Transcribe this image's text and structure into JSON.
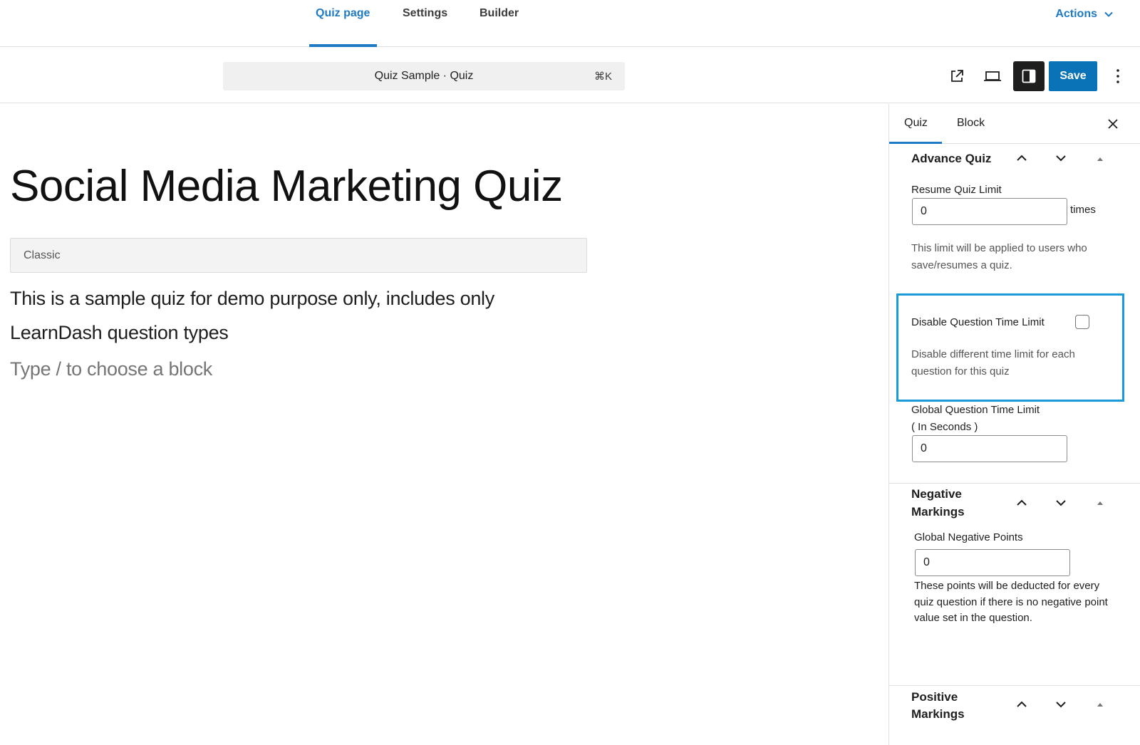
{
  "top_tabs": [
    {
      "label": "Quiz page",
      "active": true
    },
    {
      "label": "Settings",
      "active": false
    },
    {
      "label": "Builder",
      "active": false
    }
  ],
  "actions_label": "Actions",
  "command_bar": {
    "label": "Quiz Sample · Quiz",
    "shortcut": "⌘K"
  },
  "toolbar": {
    "icons": [
      "external-link-icon",
      "desktop-preview-icon",
      "sidebar-toggle-icon",
      "more-options-icon"
    ],
    "save_label": "Save"
  },
  "editor": {
    "title": "Social Media Marketing Quiz",
    "classic_block_label": "Classic",
    "paragraph": "This is a sample quiz for demo purpose only, includes only LearnDash question types",
    "placeholder": "Type / to choose a block"
  },
  "sidebar": {
    "tabs": [
      {
        "label": "Quiz",
        "active": true
      },
      {
        "label": "Block",
        "active": false
      }
    ],
    "advance_quiz": {
      "title": "Advance Quiz",
      "resume_limit_label": "Resume Quiz Limit",
      "resume_limit_value": "0",
      "resume_limit_suffix": "times",
      "resume_limit_help": "This limit will be applied to users who save/resumes a quiz.",
      "disable_time_limit_label": "Disable Question Time Limit",
      "disable_time_limit_checked": false,
      "disable_time_limit_help": "Disable different time limit for each question for this quiz",
      "global_time_limit_label_1": "Global Question Time Limit",
      "global_time_limit_label_2": "( In Seconds )",
      "global_time_limit_value": "0"
    },
    "negative_markings": {
      "title_line1": "Negative",
      "title_line2": "Markings",
      "points_label": "Global Negative Points",
      "points_value": "0",
      "help": "These points will be deducted for every quiz question if there is no negative point value set in the question."
    },
    "positive_markings": {
      "title_line1": "Positive",
      "title_line2": "Markings"
    }
  },
  "colors": {
    "accent": "#1f7ac4",
    "save_button": "#0a73b8",
    "highlight_border": "#1a9bd7"
  }
}
